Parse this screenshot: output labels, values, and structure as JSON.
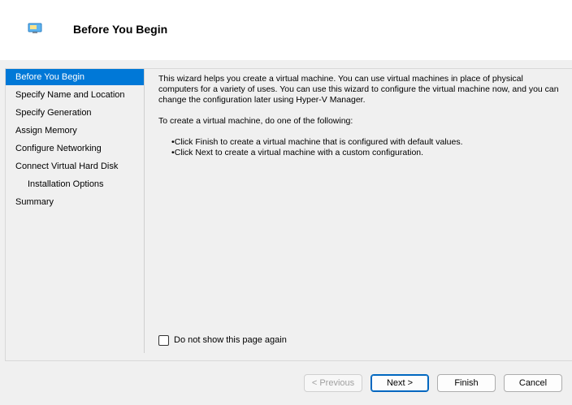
{
  "header": {
    "title": "Before You Begin",
    "icon": "virtual-machine-icon"
  },
  "nav": {
    "items": [
      {
        "label": "Before You Begin",
        "selected": true
      },
      {
        "label": "Specify Name and Location"
      },
      {
        "label": "Specify Generation"
      },
      {
        "label": "Assign Memory"
      },
      {
        "label": "Configure Networking"
      },
      {
        "label": "Connect Virtual Hard Disk"
      },
      {
        "label": "Installation Options",
        "indented": true
      },
      {
        "label": "Summary"
      }
    ]
  },
  "content": {
    "intro": "This wizard helps you create a virtual machine. You can use virtual machines in place of physical computers for a variety of uses. You can use this wizard to configure the virtual machine now, and you can change the configuration later using Hyper-V Manager.",
    "instruction": "To create a virtual machine, do one of the following:",
    "bullets": [
      "Click Finish to create a virtual machine that is configured with default values.",
      "Click Next to create a virtual machine with a custom configuration."
    ]
  },
  "checkbox": {
    "label": "Do not show this page again",
    "checked": false
  },
  "buttons": {
    "previous": "< Previous",
    "next": "Next >",
    "finish": "Finish",
    "cancel": "Cancel"
  },
  "colors": {
    "selection": "#0078d7",
    "default_button_border": "#0067c0"
  }
}
